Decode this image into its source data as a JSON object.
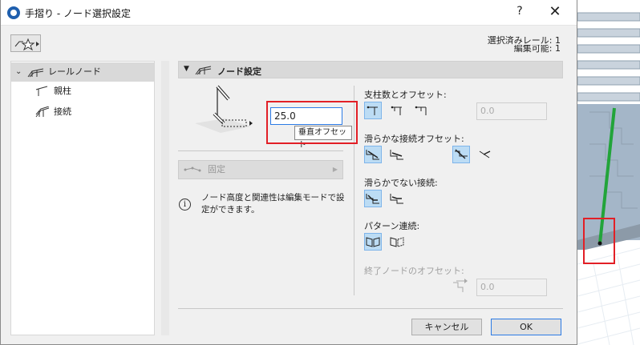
{
  "window": {
    "title": "手摺り - ノード選択設定",
    "help_label": "?",
    "close_label": "✕"
  },
  "status": {
    "line1": "選択済みレール: 1",
    "line2": "編集可能: 1"
  },
  "tree": {
    "items": [
      {
        "label": "レールノード",
        "icon": "rail-node-icon",
        "expanded": true,
        "selected": true
      },
      {
        "label": "親柱",
        "icon": "newel-post-icon"
      },
      {
        "label": "接続",
        "icon": "connection-icon"
      }
    ]
  },
  "panel": {
    "title": "ノード設定"
  },
  "offset_input": {
    "value": "25.0",
    "tooltip": "垂直オフセット"
  },
  "fixed_dropdown": {
    "label": "固定"
  },
  "info": {
    "text": "ノード高度と関連性は編集モードで設定ができます。"
  },
  "sections": {
    "post_count_label": "支柱数とオフセット:",
    "post_offset_value": "0.0",
    "smooth_label": "滑らかな接続オフセット:",
    "nonsmooth_label": "滑らかでない接続:",
    "pattern_label": "パターン連続:",
    "end_node_label": "終了ノードのオフセット:",
    "end_node_value": "0.0"
  },
  "buttons": {
    "cancel": "キャンセル",
    "ok": "OK"
  },
  "colors": {
    "accent": "#2c7be5",
    "highlight": "#e21f26",
    "selected_icon_bg": "#bcdcf4"
  }
}
